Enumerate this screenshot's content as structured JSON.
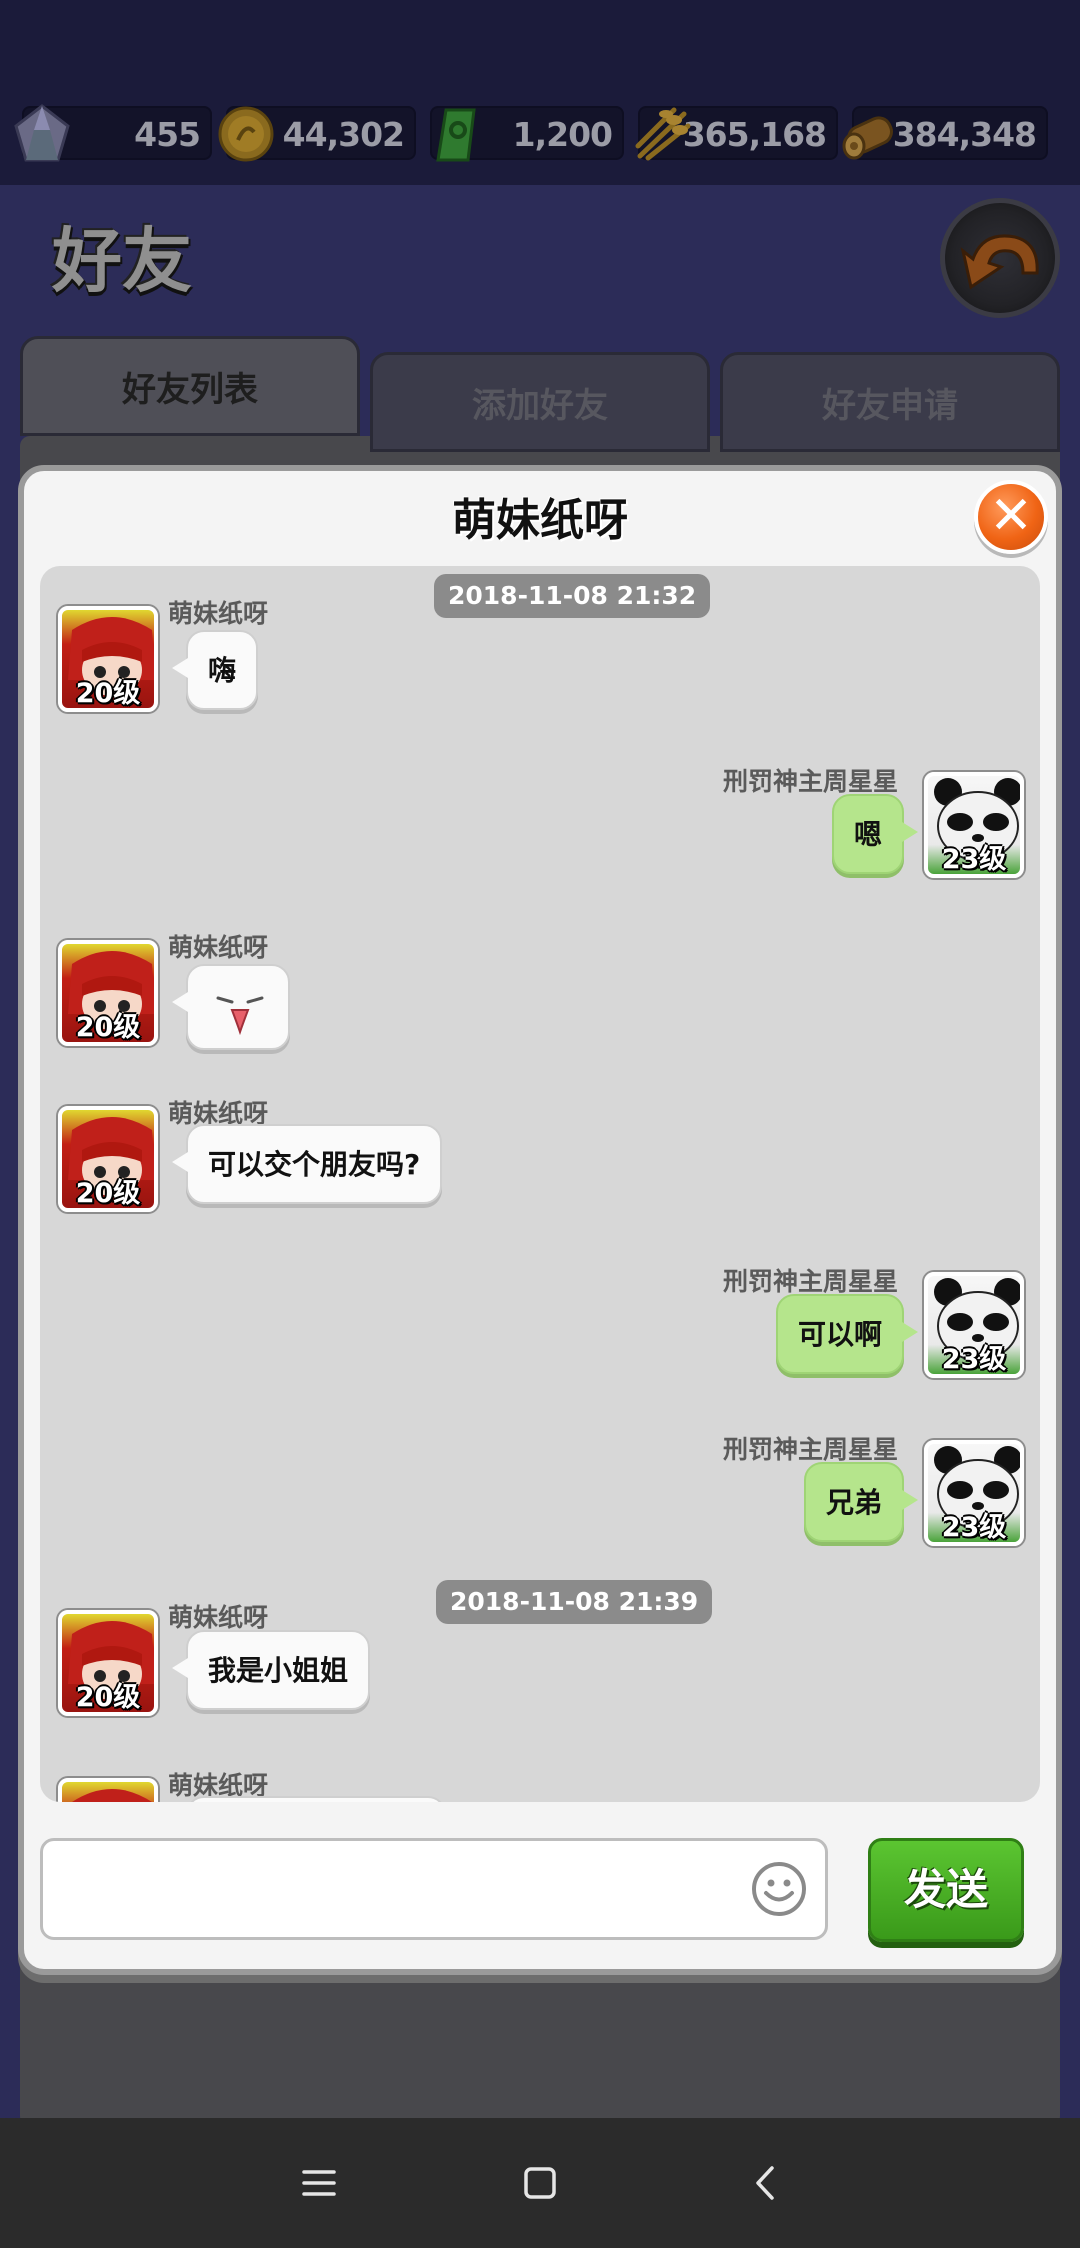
{
  "resources": [
    {
      "icon": "crystal-icon",
      "value": "455"
    },
    {
      "icon": "coin-icon",
      "value": "44,302"
    },
    {
      "icon": "gem-card-icon",
      "value": "1,200"
    },
    {
      "icon": "wheat-icon",
      "value": "365,168"
    },
    {
      "icon": "wood-log-icon",
      "value": "384,348"
    }
  ],
  "header": {
    "title": "好友",
    "back_icon": "back-arrow-icon"
  },
  "tabs": [
    {
      "label": "好友列表",
      "active": true
    },
    {
      "label": "添加好友",
      "active": false
    },
    {
      "label": "好友申请",
      "active": false
    }
  ],
  "dialog": {
    "title": "萌妹纸呀",
    "close_icon": "close-icon",
    "messages": {
      "ts1": "2018-11-08 21:32",
      "m1": {
        "sender": "萌妹纸呀",
        "level": "20级",
        "text": "嗨"
      },
      "m2": {
        "sender": "刑罚神主周星星",
        "level": "23级",
        "text": "嗯"
      },
      "m3": {
        "sender": "萌妹纸呀",
        "level": "20级",
        "emoji": "tongue-out-emoji"
      },
      "m4": {
        "sender": "萌妹纸呀",
        "level": "20级",
        "text": "可以交个朋友吗?"
      },
      "m5": {
        "sender": "刑罚神主周星星",
        "level": "23级",
        "text": "可以啊"
      },
      "m6": {
        "sender": "刑罚神主周星星",
        "level": "23级",
        "text": "兄弟"
      },
      "ts2": "2018-11-08 21:39",
      "m7": {
        "sender": "萌妹纸呀",
        "level": "20级",
        "text": "我是小姐姐"
      },
      "m8": {
        "sender": "萌妹纸呀"
      }
    },
    "input": {
      "placeholder": "",
      "value": ""
    },
    "emoji_icon": "smiley-icon",
    "send_label": "发送"
  },
  "colors": {
    "own_bubble": "#b5e58c",
    "other_bubble": "#fafafa",
    "send_button": "#4cb026",
    "close_button": "#f06415"
  },
  "navbar": [
    "menu-icon",
    "home-square-icon",
    "back-chevron-icon"
  ]
}
